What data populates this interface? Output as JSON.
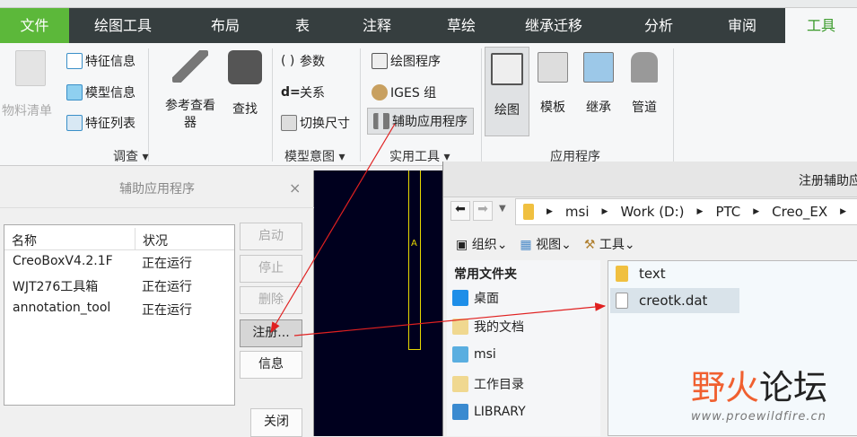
{
  "tabs": [
    "文件",
    "绘图工具",
    "布局",
    "表",
    "注释",
    "草绘",
    "继承迁移",
    "分析",
    "审阅",
    "工具"
  ],
  "ribbon": {
    "bom": "物料清单",
    "feature_info": "特征信息",
    "model_info": "模型信息",
    "feature_list": "特征列表",
    "ref_viewer": "参考查看器",
    "find": "查找",
    "params": "参数",
    "relations": "关系",
    "switch_dims": "切换尺寸",
    "draw_program": "绘图程序",
    "iges": "IGES 组",
    "aux_app": "辅助应用程序",
    "drawing": "绘图",
    "template": "模板",
    "inherit": "继承",
    "pipe": "管道",
    "groups": [
      "调查",
      "模型意图",
      "实用工具",
      "应用程序"
    ]
  },
  "aux_dialog": {
    "title": "辅助应用程序",
    "close_x": "×",
    "col_name": "名称",
    "col_status": "状况",
    "rows": [
      {
        "name": "CreoBoxV4.2.1F",
        "status": "正在运行"
      },
      {
        "name": "WJT276工具箱",
        "status": "正在运行"
      },
      {
        "name": "annotation_tool",
        "status": "正在运行"
      }
    ],
    "buttons": {
      "start": "启动",
      "stop": "停止",
      "delete": "删除",
      "register": "注册...",
      "info": "信息",
      "close": "关闭"
    }
  },
  "canvas": {
    "label": "A"
  },
  "file_dialog": {
    "title": "注册辅助应",
    "path": [
      "msi",
      "Work (D:)",
      "PTC",
      "Creo_EX"
    ],
    "toolbar": {
      "organize": "组织",
      "view": "视图",
      "tools": "工具"
    },
    "favorites_header": "常用文件夹",
    "favorites": [
      "桌面",
      "我的文档",
      "msi",
      "工作目录",
      "LIBRARY"
    ],
    "files": [
      "text",
      "creotk.dat"
    ]
  },
  "watermark": {
    "title": "野火论坛",
    "url": "www.proewildfire.cn"
  },
  "colors": {
    "file_tab": "#5cb83a",
    "tabbar": "#363e3f",
    "active_tab_text": "#3a9a2a",
    "arrow": "#e02020"
  }
}
